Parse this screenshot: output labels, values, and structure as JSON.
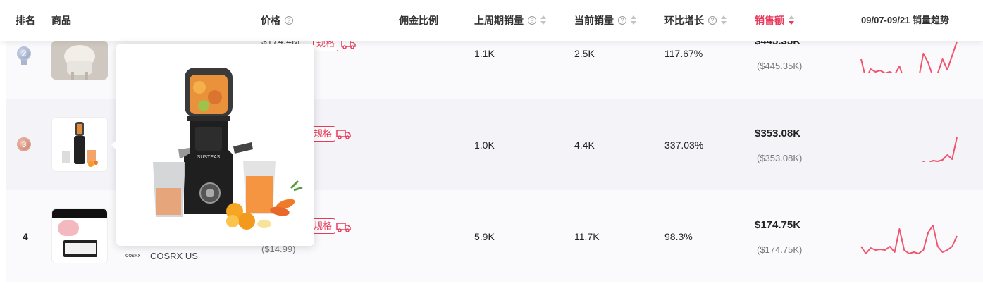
{
  "header": {
    "rank": "排名",
    "product": "商品",
    "price": "价格",
    "commission": "佣金比例",
    "last_week_sales": "上周期销量",
    "current_sales": "当前销量",
    "growth": "环比增长",
    "revenue": "销售额",
    "trend": "09/07-09/21 销量趋势",
    "help_glyph": "?"
  },
  "tag_label": "规格",
  "rows": [
    {
      "rank": "2",
      "price": "$174.4M",
      "last_week_sales": "1.1K",
      "current_sales": "2.5K",
      "growth": "117.67%",
      "revenue": "$445.35K",
      "revenue_sub": "($445.35K)",
      "trend": [
        30,
        58,
        44,
        48,
        46,
        50,
        48,
        52,
        40,
        60,
        58,
        54,
        58,
        22,
        35,
        55,
        50,
        30,
        45,
        25,
        5
      ]
    },
    {
      "rank": "3",
      "last_week_sales": "1.0K",
      "current_sales": "4.4K",
      "growth": "337.03%",
      "revenue": "$353.08K",
      "revenue_sub": "($353.08K)",
      "trend": [
        56,
        57,
        55,
        56,
        55,
        56,
        55,
        55,
        54,
        55,
        55,
        54,
        53,
        50,
        52,
        48,
        49,
        47,
        40,
        46,
        15
      ]
    },
    {
      "rank": "4",
      "price_sub": "($14.99)",
      "shop": "COSRX US",
      "brand_logo": "COSRX",
      "last_week_sales": "5.9K",
      "current_sales": "11.7K",
      "growth": "98.3%",
      "revenue": "$174.75K",
      "revenue_sub": "($174.75K)",
      "trend": [
        40,
        50,
        42,
        45,
        44,
        45,
        40,
        48,
        15,
        45,
        50,
        48,
        50,
        45,
        20,
        10,
        40,
        48,
        45,
        40,
        25
      ]
    }
  ],
  "popup": {
    "product_brand": "SUSTEAS"
  },
  "colors": {
    "accent": "#e83a5c",
    "trend_line": "#f0546e"
  }
}
